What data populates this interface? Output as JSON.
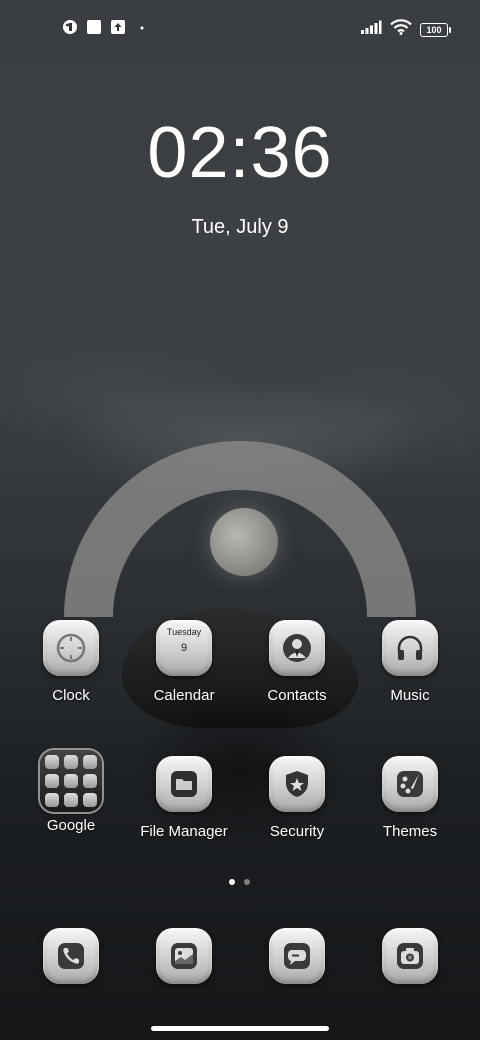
{
  "status_bar": {
    "left_icons": [
      "app-notification-icon",
      "square-notification-icon",
      "upload-icon",
      "more-dot-icon"
    ],
    "right_icons": [
      "signal-icon",
      "wifi-icon",
      "battery-icon"
    ],
    "battery_level": "100"
  },
  "clock": {
    "time": "02:36",
    "date": "Tue, July 9"
  },
  "apps_row1": [
    {
      "label": "Clock",
      "icon": "clock-icon"
    },
    {
      "label": "Calendar",
      "icon": "calendar-icon",
      "day_name": "Tuesday",
      "day_number": "9"
    },
    {
      "label": "Contacts",
      "icon": "contacts-icon"
    },
    {
      "label": "Music",
      "icon": "headphones-icon"
    }
  ],
  "apps_row2": [
    {
      "label": "Google",
      "icon": "folder-icon"
    },
    {
      "label": "File Manager",
      "icon": "file-manager-icon"
    },
    {
      "label": "Security",
      "icon": "security-shield-icon"
    },
    {
      "label": "Themes",
      "icon": "themes-palette-icon"
    }
  ],
  "dock": [
    {
      "icon": "phone-icon"
    },
    {
      "icon": "gallery-icon"
    },
    {
      "icon": "messages-icon"
    },
    {
      "icon": "camera-icon"
    }
  ],
  "page_indicator": {
    "total": 2,
    "active": 1
  }
}
